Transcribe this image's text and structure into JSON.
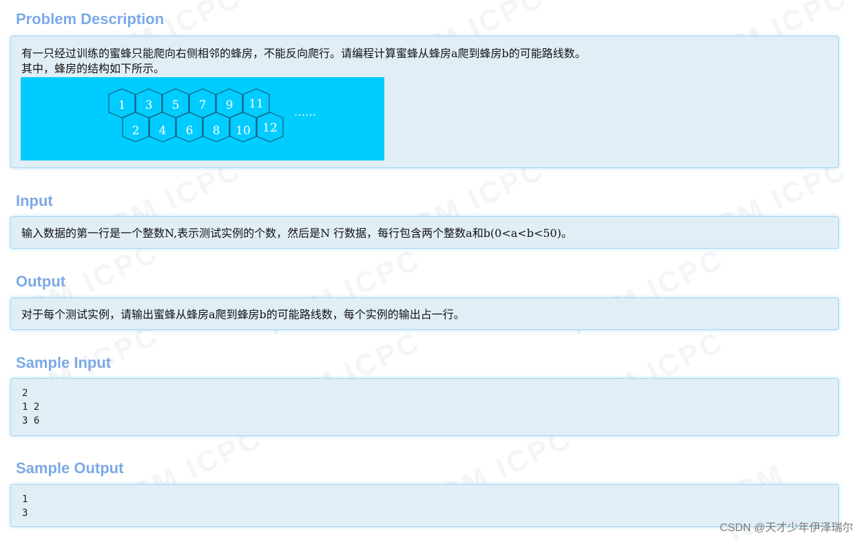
{
  "sections": {
    "problem_description": {
      "title": "Problem Description",
      "lines": [
        "有一只经过训练的蜜蜂只能爬向右侧相邻的蜂房，不能反向爬行。请编程计算蜜蜂从蜂房a爬到蜂房b的可能路线数。",
        "其中，蜂房的结构如下所示。"
      ],
      "figure": {
        "background_color": "#00ccff",
        "cells_top": [
          "1",
          "3",
          "5",
          "7",
          "9",
          "11"
        ],
        "cells_bottom": [
          "2",
          "4",
          "6",
          "8",
          "10",
          "12"
        ],
        "ellipsis": "……"
      }
    },
    "input": {
      "title": "Input",
      "text": "输入数据的第一行是一个整数N,表示测试实例的个数，然后是N 行数据，每行包含两个整数a和b(0<a<b<50)。"
    },
    "output": {
      "title": "Output",
      "text": "对于每个测试实例，请输出蜜蜂从蜂房a爬到蜂房b的可能路线数，每个实例的输出占一行。"
    },
    "sample_input": {
      "title": "Sample Input",
      "content": "2\n1 2\n3 6"
    },
    "sample_output": {
      "title": "Sample Output",
      "content": "1\n3"
    }
  },
  "watermark": "ACM ICPC",
  "credit": "CSDN @天才少年伊泽瑞尔",
  "colors": {
    "title": "#7ca9e6",
    "panel_bg": "#e1eef6",
    "panel_border": "#a6d6f0"
  }
}
